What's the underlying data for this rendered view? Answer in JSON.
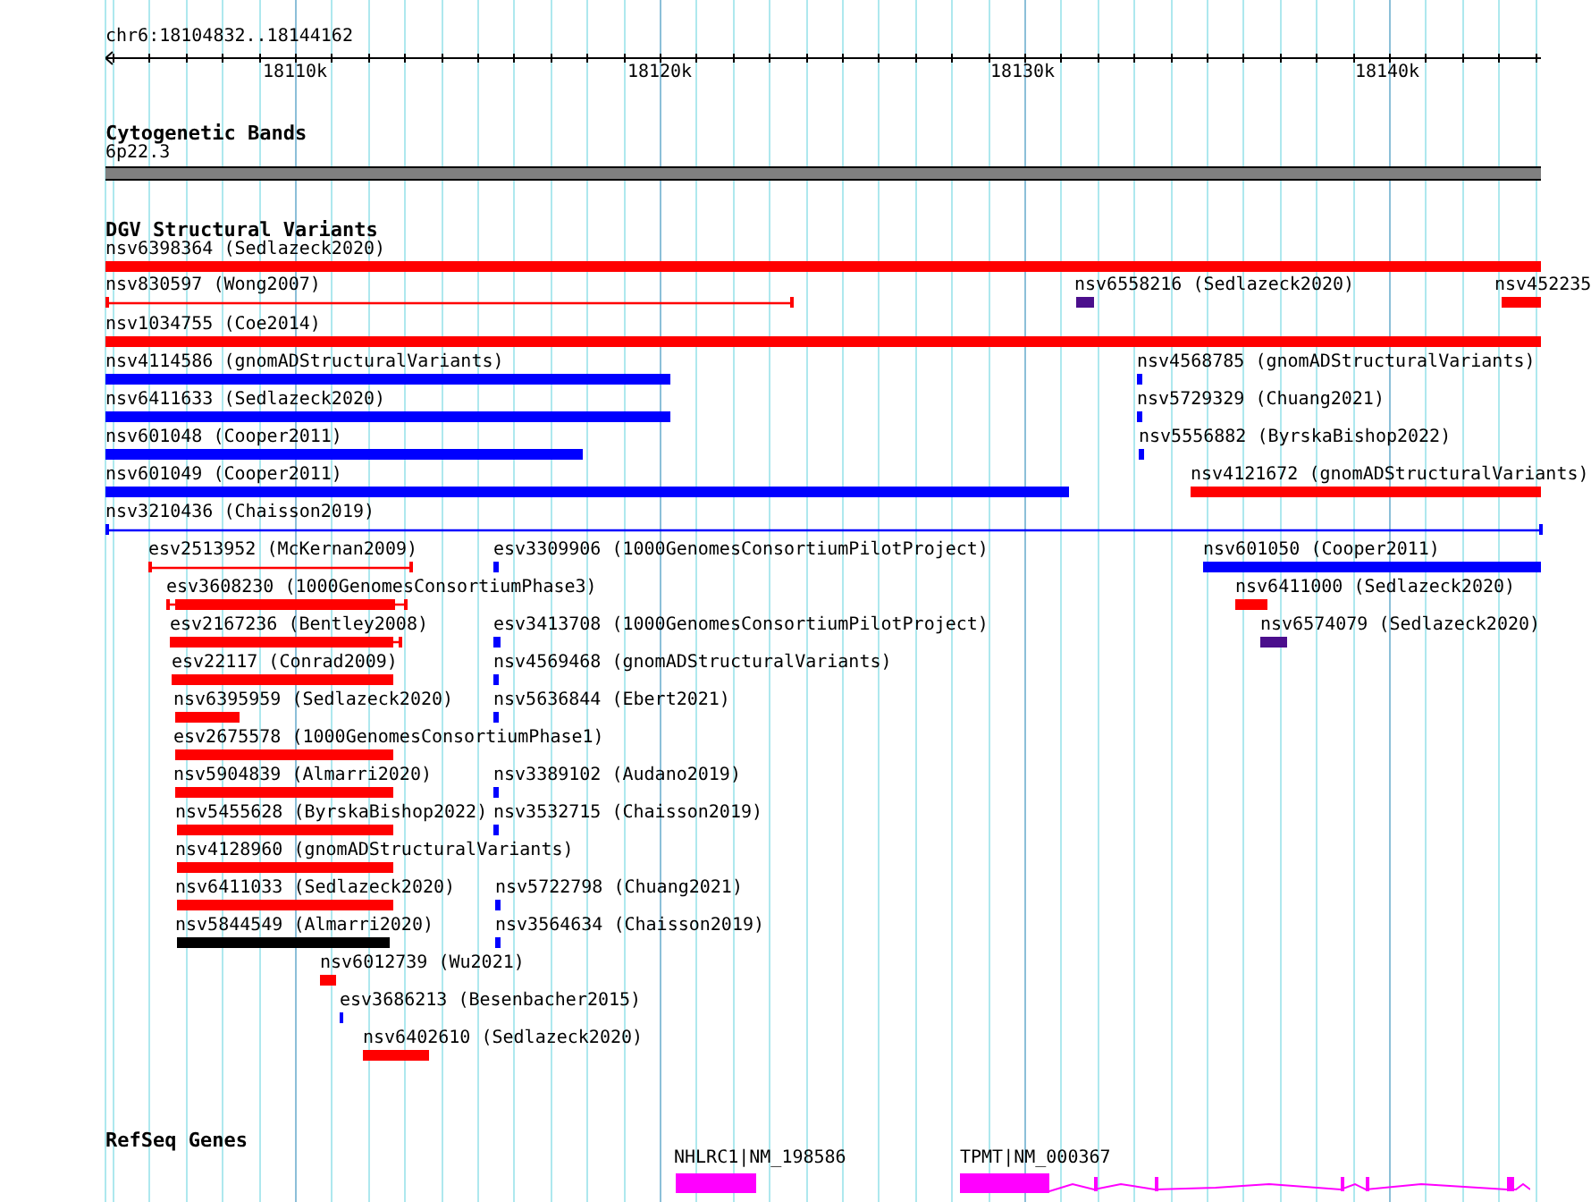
{
  "location": "chr6:18104832..18144162",
  "axis": {
    "ticks": [
      "18110k",
      "18120k",
      "18130k",
      "18140k"
    ]
  },
  "tracks": [
    {
      "title": "Cytogenetic Bands",
      "features": [
        {
          "label": "6p22.3",
          "kind": "band",
          "color": "#808080"
        }
      ]
    },
    {
      "title": "DGV Structural Variants",
      "features": [
        {
          "label": "nsv6398364 (Sedlazeck2020)",
          "kind": "bar",
          "color": "#ff0000"
        },
        {
          "label": "nsv830597 (Wong2007)",
          "kind": "line",
          "color": "#ff0000"
        },
        {
          "label": "nsv6558216 (Sedlazeck2020)",
          "kind": "bar",
          "color": "#4b0f8c"
        },
        {
          "label": "nsv452235",
          "kind": "bar",
          "color": "#ff0000"
        },
        {
          "label": "nsv1034755 (Coe2014)",
          "kind": "bar",
          "color": "#ff0000"
        },
        {
          "label": "nsv4114586 (gnomADStructuralVariants)",
          "kind": "bar",
          "color": "#0000ff"
        },
        {
          "label": "nsv4568785 (gnomADStructuralVariants)",
          "kind": "bar",
          "color": "#0000ff"
        },
        {
          "label": "nsv6411633 (Sedlazeck2020)",
          "kind": "bar",
          "color": "#0000ff"
        },
        {
          "label": "nsv5729329 (Chuang2021)",
          "kind": "bar",
          "color": "#0000ff"
        },
        {
          "label": "nsv601048 (Cooper2011)",
          "kind": "bar",
          "color": "#0000ff"
        },
        {
          "label": "nsv5556882 (ByrskaBishop2022)",
          "kind": "bar",
          "color": "#0000ff"
        },
        {
          "label": "nsv601049 (Cooper2011)",
          "kind": "bar",
          "color": "#0000ff"
        },
        {
          "label": "nsv4121672 (gnomADStructuralVariants)",
          "kind": "bar",
          "color": "#ff0000"
        },
        {
          "label": "nsv3210436 (Chaisson2019)",
          "kind": "line",
          "color": "#0000ff"
        },
        {
          "label": "esv2513952 (McKernan2009)",
          "kind": "line",
          "color": "#ff0000"
        },
        {
          "label": "esv3309906 (1000GenomesConsortiumPilotProject)",
          "kind": "bar",
          "color": "#0000ff"
        },
        {
          "label": "nsv601050 (Cooper2011)",
          "kind": "bar",
          "color": "#0000ff"
        },
        {
          "label": "esv3608230 (1000GenomesConsortiumPhase3)",
          "kind": "whisker",
          "color": "#ff0000"
        },
        {
          "label": "nsv6411000 (Sedlazeck2020)",
          "kind": "bar",
          "color": "#ff0000"
        },
        {
          "label": "esv2167236 (Bentley2008)",
          "kind": "whisker",
          "color": "#ff0000"
        },
        {
          "label": "esv3413708 (1000GenomesConsortiumPilotProject)",
          "kind": "bar",
          "color": "#0000ff"
        },
        {
          "label": "nsv6574079 (Sedlazeck2020)",
          "kind": "bar",
          "color": "#4b0f8c"
        },
        {
          "label": "esv22117 (Conrad2009)",
          "kind": "bar",
          "color": "#ff0000"
        },
        {
          "label": "nsv4569468 (gnomADStructuralVariants)",
          "kind": "bar",
          "color": "#0000ff"
        },
        {
          "label": "nsv6395959 (Sedlazeck2020)",
          "kind": "bar",
          "color": "#ff0000"
        },
        {
          "label": "nsv5636844 (Ebert2021)",
          "kind": "bar",
          "color": "#0000ff"
        },
        {
          "label": "esv2675578 (1000GenomesConsortiumPhase1)",
          "kind": "bar",
          "color": "#ff0000"
        },
        {
          "label": "nsv5904839 (Almarri2020)",
          "kind": "bar",
          "color": "#ff0000"
        },
        {
          "label": "nsv3389102 (Audano2019)",
          "kind": "bar",
          "color": "#0000ff"
        },
        {
          "label": "nsv5455628 (ByrskaBishop2022)",
          "kind": "bar",
          "color": "#ff0000"
        },
        {
          "label": "nsv3532715 (Chaisson2019)",
          "kind": "bar",
          "color": "#0000ff"
        },
        {
          "label": "nsv4128960 (gnomADStructuralVariants)",
          "kind": "bar",
          "color": "#ff0000"
        },
        {
          "label": "nsv6411033 (Sedlazeck2020)",
          "kind": "bar",
          "color": "#ff0000"
        },
        {
          "label": "nsv5722798 (Chuang2021)",
          "kind": "bar",
          "color": "#0000ff"
        },
        {
          "label": "nsv5844549 (Almarri2020)",
          "kind": "bar",
          "color": "#000000"
        },
        {
          "label": "nsv3564634 (Chaisson2019)",
          "kind": "bar",
          "color": "#0000ff"
        },
        {
          "label": "nsv6012739 (Wu2021)",
          "kind": "bar",
          "color": "#ff0000"
        },
        {
          "label": "esv3686213 (Besenbacher2015)",
          "kind": "bar",
          "color": "#0000ff"
        },
        {
          "label": "nsv6402610 (Sedlazeck2020)",
          "kind": "bar",
          "color": "#ff0000"
        }
      ]
    },
    {
      "title": "RefSeq Genes",
      "features": [
        {
          "label": "NHLRC1|NM_198586",
          "kind": "gene",
          "color": "#ff00ff"
        },
        {
          "label": "TPMT|NM_000367",
          "kind": "gene-introns",
          "color": "#ff00ff"
        }
      ]
    }
  ]
}
